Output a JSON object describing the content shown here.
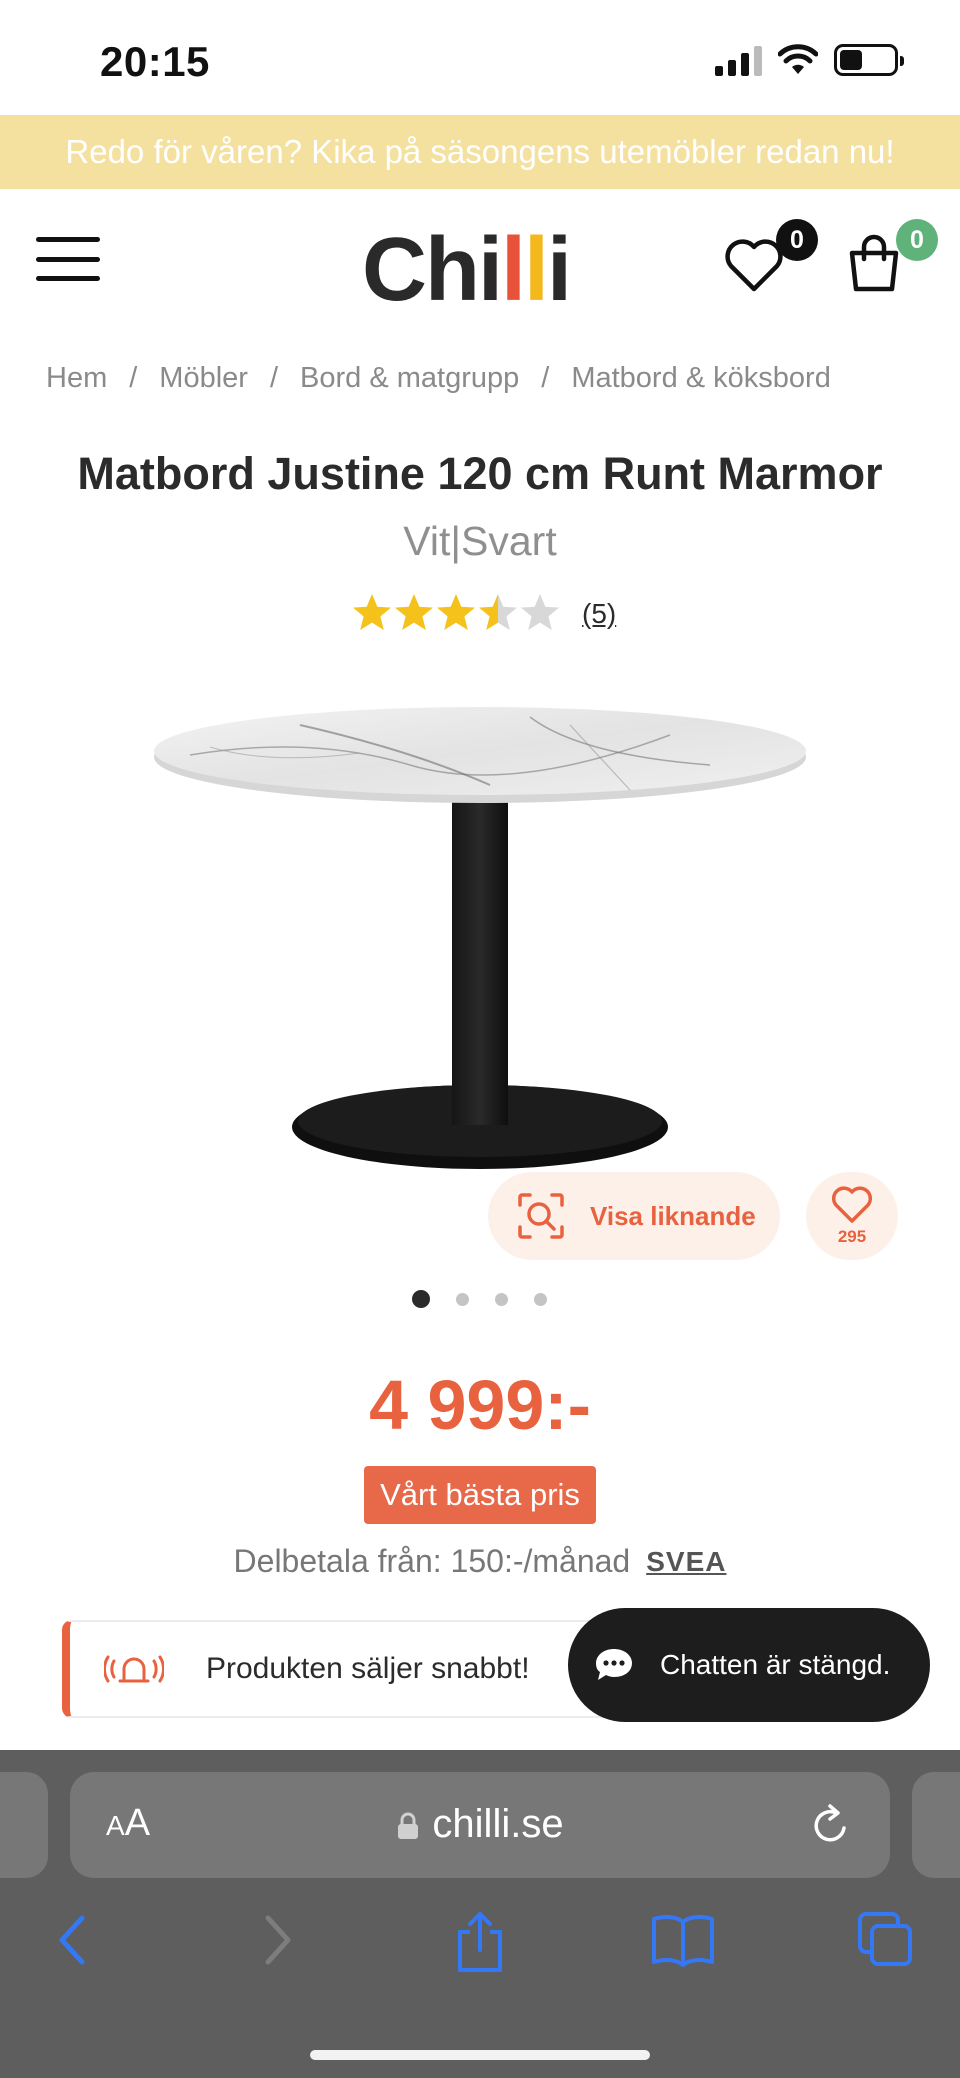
{
  "status_bar": {
    "time": "20:15"
  },
  "promo": {
    "text": "Redo för våren? Kika på säsongens utemöbler redan nu!"
  },
  "header": {
    "logo": {
      "part1": "Ch",
      "part2": "i",
      "part3": "l",
      "part4": "l",
      "part5": "i"
    },
    "wishlist_count": "0",
    "cart_count": "0"
  },
  "breadcrumb": [
    {
      "label": "Hem"
    },
    {
      "label": "Möbler"
    },
    {
      "label": "Bord & matgrupp"
    },
    {
      "label": "Matbord & köksbord"
    }
  ],
  "product": {
    "title": "Matbord Justine 120 cm Runt Marmor",
    "variant": "Vit|Svart",
    "rating_value": 3.5,
    "rating_max": 5,
    "review_count": "(5)",
    "image_alt": "Matbord Justine marmor",
    "similar_label": "Visa liknande",
    "favorites_count": "295",
    "image_index": 1,
    "image_total": 4,
    "price": "4 999:-",
    "price_badge": "Vårt bästa pris",
    "installment": "Delbetala från: 150:-/månad",
    "installment_provider": "SVEA",
    "sells_fast": "Produkten säljer snabbt!"
  },
  "chat": {
    "label": "Chatten är stängd."
  },
  "browser": {
    "text_size_label_small": "A",
    "text_size_label_large": "A",
    "url": "chilli.se"
  },
  "colors": {
    "accent": "#e8623f",
    "promo_bg": "#f4e1a0",
    "wishlist_badge": "#111111",
    "cart_badge": "#5fb37a",
    "star": "#f4c21b",
    "ios_blue": "#3478f6"
  }
}
